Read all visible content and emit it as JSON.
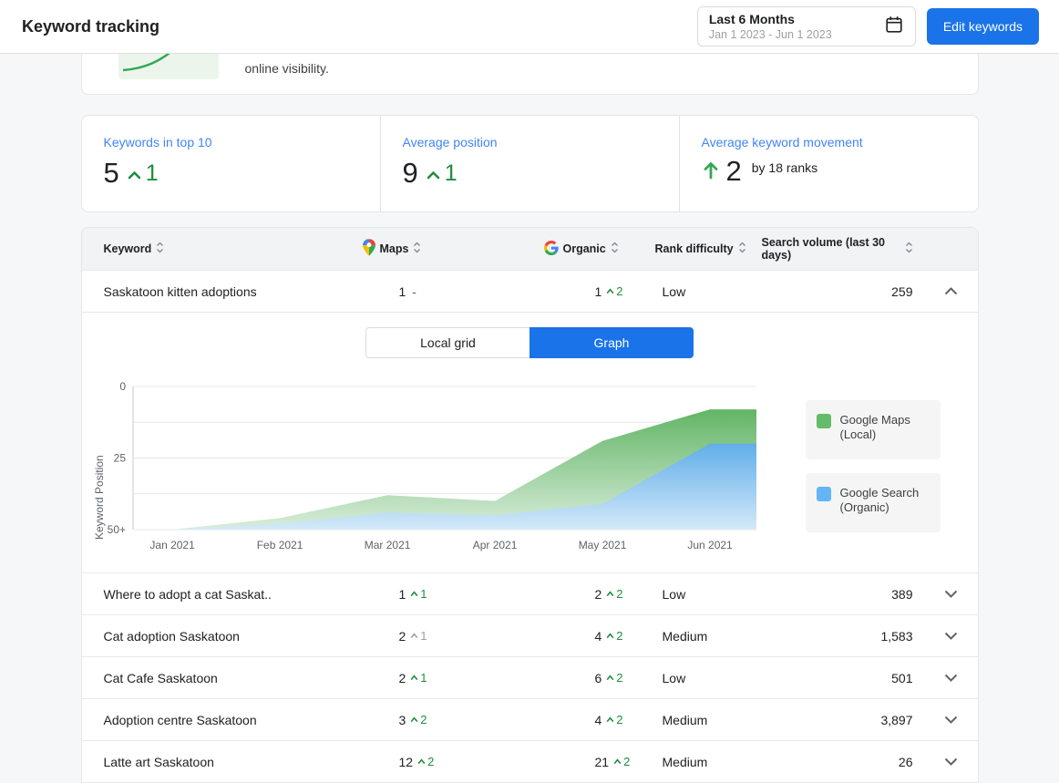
{
  "header": {
    "title": "Keyword tracking",
    "date_range": {
      "label": "Last 6 Months",
      "range": "Jan 1 2023 - Jun 1 2023"
    },
    "edit_keywords_label": "Edit keywords"
  },
  "intro_card": {
    "text": "online visibility."
  },
  "stats": {
    "top10": {
      "title": "Keywords in top 10",
      "value": "5",
      "delta": "1"
    },
    "avg_position": {
      "title": "Average position",
      "value": "9",
      "delta": "1"
    },
    "movement": {
      "title": "Average keyword movement",
      "value": "2",
      "note": "by 18 ranks"
    }
  },
  "table": {
    "columns": {
      "keyword": "Keyword",
      "maps": "Maps",
      "organic": "Organic",
      "difficulty": "Rank difficulty",
      "volume": "Search volume (last 30 days)"
    },
    "rows": [
      {
        "keyword": "Saskatoon kitten adoptions",
        "maps": "1",
        "maps_delta": "-",
        "maps_state": "none",
        "organic": "1",
        "organic_delta": "2",
        "organic_state": "up",
        "difficulty": "Low",
        "volume": "259",
        "expanded": true
      },
      {
        "keyword": "Where to adopt a cat Saskat..",
        "maps": "1",
        "maps_delta": "1",
        "maps_state": "up",
        "organic": "2",
        "organic_delta": "2",
        "organic_state": "up",
        "difficulty": "Low",
        "volume": "389",
        "expanded": false
      },
      {
        "keyword": "Cat adoption Saskatoon",
        "maps": "2",
        "maps_delta": "1",
        "maps_state": "muted",
        "organic": "4",
        "organic_delta": "2",
        "organic_state": "up",
        "difficulty": "Medium",
        "volume": "1,583",
        "expanded": false
      },
      {
        "keyword": "Cat Cafe Saskatoon",
        "maps": "2",
        "maps_delta": "1",
        "maps_state": "up",
        "organic": "6",
        "organic_delta": "2",
        "organic_state": "up",
        "difficulty": "Low",
        "volume": "501",
        "expanded": false
      },
      {
        "keyword": "Adoption centre Saskatoon",
        "maps": "3",
        "maps_delta": "2",
        "maps_state": "up",
        "organic": "4",
        "organic_delta": "2",
        "organic_state": "up",
        "difficulty": "Medium",
        "volume": "3,897",
        "expanded": false
      },
      {
        "keyword": "Latte art Saskatoon",
        "maps": "12",
        "maps_delta": "2",
        "maps_state": "up",
        "organic": "21",
        "organic_delta": "2",
        "organic_state": "up",
        "difficulty": "Medium",
        "volume": "26",
        "expanded": false
      }
    ]
  },
  "detail": {
    "tabs": [
      "Local grid",
      "Graph"
    ],
    "active_tab": "Graph",
    "legend": [
      {
        "line1": "Google Maps",
        "line2": "(Local)",
        "color": "#66bb6a"
      },
      {
        "line1": "Google Search",
        "line2": "(Organic)",
        "color": "#64b5f6"
      }
    ]
  },
  "colors": {
    "accent": "#1a73e8",
    "positive": "#1e8e3e",
    "muted": "#9aa0a6"
  },
  "chart_data": {
    "type": "area",
    "title": "Keyword position over time for Saskatoon kitten adoptions",
    "x": [
      "Jan 2021",
      "Feb 2021",
      "Mar 2021",
      "Apr 2021",
      "May 2021",
      "Jun 2021"
    ],
    "y_axis_label": "Keyword Position",
    "y_ticks": [
      "0",
      "25",
      "50+"
    ],
    "y_inverted": true,
    "ylim": [
      0,
      50
    ],
    "grid": true,
    "legend_position": "right",
    "series": [
      {
        "name": "Google Maps (Local)",
        "color_top": "#62b566",
        "color_bottom": "#d9edda",
        "values": [
          50,
          46,
          38,
          40,
          19,
          8
        ]
      },
      {
        "name": "Google Search (Organic)",
        "color_top": "#61aee9",
        "color_bottom": "#d4e9f9",
        "values": [
          50,
          48,
          44,
          45,
          41,
          20
        ]
      }
    ]
  }
}
